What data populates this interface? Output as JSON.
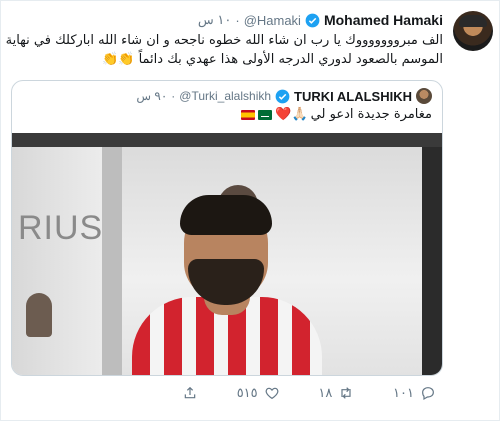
{
  "tweet": {
    "display_name": "Mohamed Hamaki",
    "handle": "@Hamaki",
    "separator": "·",
    "time": "١٠ س",
    "text": "الف مبروووووووك يا رب ان شاء الله خطوه ناجحه و ان شاء الله اباركلك في نهاية الموسم بالصعود لدوري الدرجه الأولى هذا عهدي بك دائماً 👏👏"
  },
  "quote": {
    "display_name": "TURKI ALALSHIKH",
    "handle": "@Turki_alalshikh",
    "separator": "·",
    "time": "٩٠ س",
    "text": "مغامرة جديدة ادعو لي",
    "emoji": "🙏🏻❤️",
    "photo_sign_text": "RIUS"
  },
  "actions": {
    "replies": "١٠١",
    "retweets": "١٨",
    "likes": "٥١٥",
    "share": ""
  },
  "colors": {
    "verified": "#1da1f2",
    "secondary_text": "#657786",
    "border": "#ccd6dd"
  }
}
